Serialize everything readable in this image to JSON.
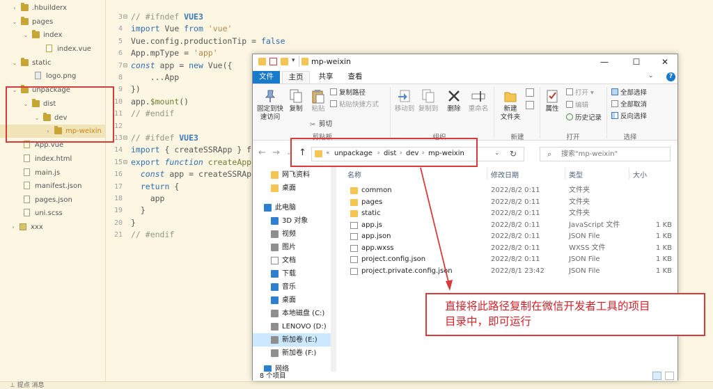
{
  "sidebar": {
    "items": [
      {
        "label": ".hbuilderx",
        "kind": "folder",
        "expanded": false,
        "depth": 1
      },
      {
        "label": "pages",
        "kind": "folder",
        "expanded": true,
        "depth": 1
      },
      {
        "label": "index",
        "kind": "folder",
        "expanded": true,
        "depth": 2
      },
      {
        "label": "index.vue",
        "kind": "file-vue",
        "depth": 3
      },
      {
        "label": "static",
        "kind": "folder",
        "expanded": true,
        "depth": 1
      },
      {
        "label": "logo.png",
        "kind": "file-img",
        "depth": 2
      },
      {
        "label": "unpackage",
        "kind": "folder",
        "expanded": true,
        "depth": 1
      },
      {
        "label": "dist",
        "kind": "folder",
        "expanded": true,
        "depth": 2
      },
      {
        "label": "dev",
        "kind": "folder",
        "expanded": true,
        "depth": 3
      },
      {
        "label": "mp-weixin",
        "kind": "folder",
        "expanded": false,
        "depth": 4,
        "selected": true
      },
      {
        "label": "App.vue",
        "kind": "file-vue",
        "depth": 1
      },
      {
        "label": "index.html",
        "kind": "file",
        "depth": 1
      },
      {
        "label": "main.js",
        "kind": "file",
        "depth": 1
      },
      {
        "label": "manifest.json",
        "kind": "file",
        "depth": 1
      },
      {
        "label": "pages.json",
        "kind": "file",
        "depth": 1
      },
      {
        "label": "uni.scss",
        "kind": "file",
        "depth": 1
      },
      {
        "label": "xxx",
        "kind": "project",
        "expanded": false,
        "depth": 0
      }
    ]
  },
  "editor": {
    "lines": [
      {
        "n": "3",
        "fold": "⊟",
        "tokens": [
          [
            "cm",
            "// #ifndef "
          ],
          [
            "cm-b",
            "VUE3"
          ]
        ]
      },
      {
        "n": "4",
        "fold": "",
        "tokens": [
          [
            "kw",
            "import "
          ],
          [
            "pl",
            "Vue "
          ],
          [
            "kw",
            "from "
          ],
          [
            "str",
            "'vue'"
          ]
        ]
      },
      {
        "n": "5",
        "fold": "",
        "tokens": [
          [
            "pl",
            "Vue.config.productionTip = "
          ],
          [
            "kw",
            "false"
          ]
        ]
      },
      {
        "n": "6",
        "fold": "",
        "tokens": [
          [
            "pl",
            "App.mpType = "
          ],
          [
            "str",
            "'app'"
          ]
        ]
      },
      {
        "n": "7",
        "fold": "⊟",
        "tokens": [
          [
            "kw-i",
            "const "
          ],
          [
            "pl",
            "app = "
          ],
          [
            "kw",
            "new "
          ],
          [
            "pl",
            "Vue({"
          ]
        ]
      },
      {
        "n": "8",
        "fold": "",
        "tokens": [
          [
            "pl",
            "    ...App"
          ]
        ]
      },
      {
        "n": "9",
        "fold": "",
        "tokens": [
          [
            "pl",
            "})"
          ]
        ]
      },
      {
        "n": "10",
        "fold": "",
        "tokens": [
          [
            "pl",
            "app."
          ],
          [
            "fn",
            "$mount"
          ],
          [
            "pl",
            "()"
          ]
        ]
      },
      {
        "n": "11",
        "fold": "",
        "tokens": [
          [
            "cm",
            "// #endif"
          ]
        ]
      },
      {
        "n": "12",
        "fold": "",
        "tokens": []
      },
      {
        "n": "13",
        "fold": "⊟",
        "tokens": [
          [
            "cm",
            "// #ifdef "
          ],
          [
            "cm-b",
            "VUE3"
          ]
        ]
      },
      {
        "n": "14",
        "fold": "",
        "tokens": [
          [
            "kw",
            "import "
          ],
          [
            "pl",
            "{ createSSRApp } f"
          ]
        ]
      },
      {
        "n": "15",
        "fold": "⊟",
        "tokens": [
          [
            "kw",
            "export "
          ],
          [
            "kw-i",
            "function "
          ],
          [
            "fn",
            "createApp"
          ]
        ]
      },
      {
        "n": "16",
        "fold": "",
        "tokens": [
          [
            "pl",
            "  "
          ],
          [
            "kw-i",
            "const "
          ],
          [
            "pl",
            "app = createSSRAp"
          ]
        ]
      },
      {
        "n": "17",
        "fold": "",
        "tokens": [
          [
            "pl",
            "  "
          ],
          [
            "kw",
            "return "
          ],
          [
            "pl",
            "{"
          ]
        ]
      },
      {
        "n": "18",
        "fold": "",
        "tokens": [
          [
            "pl",
            "    app"
          ]
        ]
      },
      {
        "n": "19",
        "fold": "",
        "tokens": [
          [
            "pl",
            "  }"
          ]
        ]
      },
      {
        "n": "20",
        "fold": "",
        "tokens": [
          [
            "pl",
            "}"
          ]
        ]
      },
      {
        "n": "21",
        "fold": "",
        "tokens": [
          [
            "cm",
            "// #endif"
          ]
        ]
      }
    ]
  },
  "bottom_bar": {
    "text": "⊥ 提点  消息"
  },
  "explorer": {
    "title": "mp-weixin",
    "window_buttons": {
      "minimize": "—",
      "maximize": "☐",
      "close": "✕"
    },
    "tabs": {
      "file": "文件",
      "home": "主页",
      "share": "共享",
      "view": "查看"
    },
    "ribbon": {
      "pin": "固定到快\n速访问",
      "copy": "复制",
      "paste": "粘贴",
      "copy_path": "复制路径",
      "paste_shortcut": "粘贴快捷方式",
      "cut": "剪切",
      "clipboard_group": "剪贴板",
      "move_to": "移动到",
      "copy_to": "复制到",
      "delete": "删除",
      "rename": "重命名",
      "organize_group": "组织",
      "new_folder": "新建\n文件夹",
      "new_group": "新建",
      "properties": "属性",
      "open": "打开",
      "edit": "编辑",
      "history": "历史记录",
      "open_group": "打开",
      "select_all": "全部选择",
      "select_none": "全部取消",
      "invert": "反向选择",
      "select_group": "选择"
    },
    "address": {
      "prefix": "«",
      "crumbs": [
        "unpackage",
        "dist",
        "dev",
        "mp-weixin"
      ],
      "search_placeholder": "搜索\"mp-weixin\""
    },
    "nav": [
      {
        "label": "网飞资料",
        "icon": "folder-icon"
      },
      {
        "label": "桌面",
        "icon": "folder-icon"
      },
      {
        "label": "此电脑",
        "icon": "computer-icon"
      },
      {
        "label": "3D 对象",
        "icon": "cube-icon"
      },
      {
        "label": "视频",
        "icon": "video-icon"
      },
      {
        "label": "图片",
        "icon": "picture-icon"
      },
      {
        "label": "文档",
        "icon": "document-icon"
      },
      {
        "label": "下载",
        "icon": "download-icon"
      },
      {
        "label": "音乐",
        "icon": "music-icon"
      },
      {
        "label": "桌面",
        "icon": "desktop-icon"
      },
      {
        "label": "本地磁盘 (C:)",
        "icon": "drive-icon"
      },
      {
        "label": "LENOVO (D:)",
        "icon": "drive-icon"
      },
      {
        "label": "新加卷 (E:)",
        "icon": "drive-icon",
        "selected": true
      },
      {
        "label": "新加卷 (F:)",
        "icon": "drive-icon"
      },
      {
        "label": "网络",
        "icon": "network-icon"
      }
    ],
    "columns": {
      "name": "名称",
      "date": "修改日期",
      "type": "类型",
      "size": "大小"
    },
    "files": [
      {
        "name": "common",
        "date": "2022/8/2 0:11",
        "type": "文件夹",
        "size": "",
        "icon": "folder-icon"
      },
      {
        "name": "pages",
        "date": "2022/8/2 0:11",
        "type": "文件夹",
        "size": "",
        "icon": "folder-icon"
      },
      {
        "name": "static",
        "date": "2022/8/2 0:11",
        "type": "文件夹",
        "size": "",
        "icon": "folder-icon"
      },
      {
        "name": "app.js",
        "date": "2022/8/2 0:11",
        "type": "JavaScript 文件",
        "size": "1 KB",
        "icon": "js-file-icon"
      },
      {
        "name": "app.json",
        "date": "2022/8/2 0:11",
        "type": "JSON File",
        "size": "1 KB",
        "icon": "json-file-icon"
      },
      {
        "name": "app.wxss",
        "date": "2022/8/2 0:11",
        "type": "WXSS 文件",
        "size": "1 KB",
        "icon": "wxss-file-icon"
      },
      {
        "name": "project.config.json",
        "date": "2022/8/2 0:11",
        "type": "JSON File",
        "size": "1 KB",
        "icon": "json-file-icon"
      },
      {
        "name": "project.private.config.json",
        "date": "2022/8/1 23:42",
        "type": "JSON File",
        "size": "1 KB",
        "icon": "json-file-icon"
      }
    ],
    "status": "8 个项目"
  },
  "annotation": {
    "line1": "直接将此路径复制在微信开发者工具的项目",
    "line2": "目录中，即可运行",
    "color": "#d1232a"
  }
}
